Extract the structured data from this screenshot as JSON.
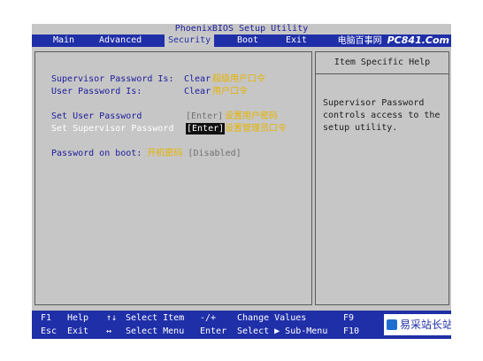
{
  "title": "PhoenixBIOS Setup Utility",
  "menu": [
    {
      "label": "Main",
      "active": false
    },
    {
      "label": "Advanced",
      "active": false
    },
    {
      "label": "Security",
      "active": true
    },
    {
      "label": "Boot",
      "active": false
    },
    {
      "label": "Exit",
      "active": false
    }
  ],
  "watermark": {
    "text": "电脑百事网",
    "logo": "PC841.Com"
  },
  "fields": {
    "supervisor_status": {
      "label": "Supervisor Password Is:",
      "value": "Clear",
      "note": "超级用户口令"
    },
    "user_status": {
      "label": "User Password Is:",
      "value": "Clear",
      "note": "用户口令"
    },
    "set_user": {
      "label": "Set User Password",
      "value": "[Enter]",
      "note": "设置用户密码"
    },
    "set_supervisor": {
      "label": "Set Supervisor Password",
      "value": "[Enter]",
      "note": "设置管理员口令"
    },
    "boot_password": {
      "label": "Password on boot:",
      "value": "[Disabled]",
      "note": "开机密码"
    }
  },
  "help": {
    "title": "Item Specific Help",
    "text": "Supervisor Password controls access to the setup utility."
  },
  "footer": {
    "row1": [
      {
        "key": "F1",
        "action": "Help"
      },
      {
        "key": "↑↓",
        "action": "Select Item"
      },
      {
        "key": "-/+",
        "action": "Change Values"
      },
      {
        "key": "F9",
        "action": ""
      }
    ],
    "row2": [
      {
        "key": "Esc",
        "action": "Exit"
      },
      {
        "key": "↔",
        "action": "Select Menu"
      },
      {
        "key": "Enter",
        "action": "Select ▶ Sub-Menu"
      },
      {
        "key": "F10",
        "action": ""
      }
    ]
  },
  "site_logo": {
    "text": "易采站长站",
    "icon": "site-logo-icon"
  },
  "colors": {
    "menu_bar": "#1f2fa8",
    "panel": "#c6c6c6",
    "label": "#1c1c9c",
    "note": "#e6b400"
  }
}
